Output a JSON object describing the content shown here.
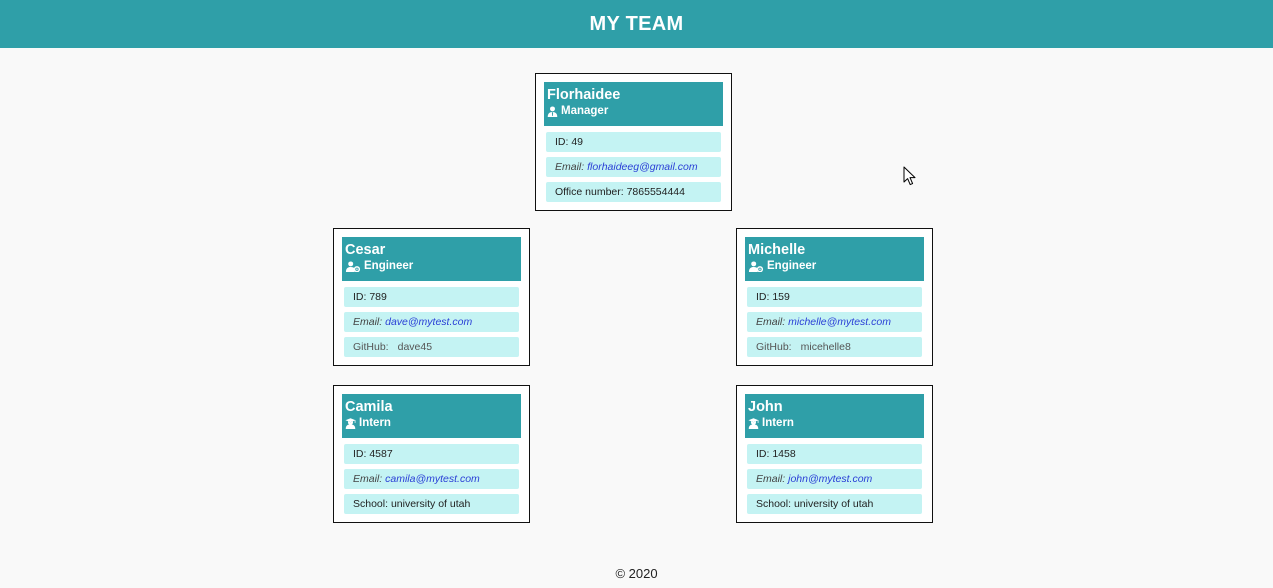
{
  "header": {
    "title": "MY TEAM"
  },
  "manager": {
    "name": "Florhaidee",
    "role": "Manager",
    "id_text": "ID: 49",
    "email_label": "Email:",
    "email": "florhaideeg@gmail.com",
    "office_text": "Office number: 7865554444"
  },
  "engineer1": {
    "name": "Cesar",
    "role": "Engineer",
    "id_text": "ID: 789",
    "email_label": "Email:",
    "email": "dave@mytest.com",
    "github_label": "GitHub:",
    "github": "dave45"
  },
  "engineer2": {
    "name": "Michelle",
    "role": "Engineer",
    "id_text": "ID: 159",
    "email_label": "Email:",
    "email": "michelle@mytest.com",
    "github_label": "GitHub:",
    "github": "micehelle8"
  },
  "intern1": {
    "name": "Camila",
    "role": "Intern",
    "id_text": "ID: 4587",
    "email_label": "Email:",
    "email": "camila@mytest.com",
    "school_text": "School: university of utah"
  },
  "intern2": {
    "name": "John",
    "role": "Intern",
    "id_text": "ID: 1458",
    "email_label": "Email:",
    "email": "john@mytest.com",
    "school_text": "School: university of utah"
  },
  "footer": {
    "text": "© 2020"
  },
  "icons": {
    "manager": "user-tie-icon",
    "engineer": "user-cog-icon",
    "intern": "user-graduate-icon"
  },
  "colors": {
    "header_bg": "#2f9fa8",
    "row_bg": "#c4f3f3",
    "link": "#2a3fd6"
  }
}
